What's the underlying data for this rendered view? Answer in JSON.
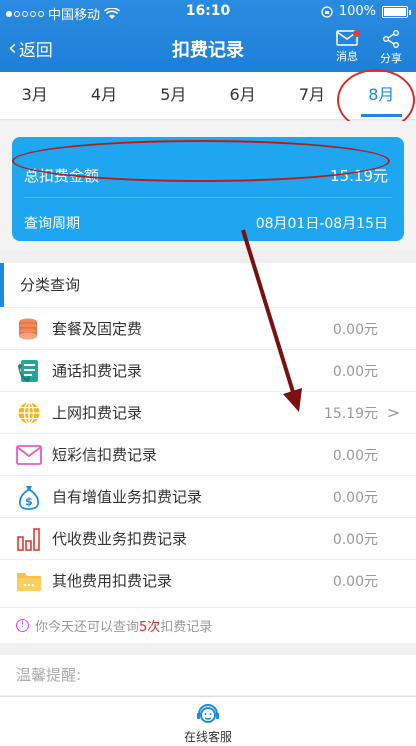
{
  "status_bar": {
    "carrier": "中国移动",
    "time": "16:10",
    "battery": "100%"
  },
  "nav": {
    "back_label": "返回",
    "title": "扣费记录",
    "message_label": "消息",
    "share_label": "分享"
  },
  "month_tabs": [
    {
      "label": "3月",
      "active": false
    },
    {
      "label": "4月",
      "active": false
    },
    {
      "label": "5月",
      "active": false
    },
    {
      "label": "6月",
      "active": false
    },
    {
      "label": "7月",
      "active": false
    },
    {
      "label": "8月",
      "active": true
    }
  ],
  "summary": {
    "total_label": "总扣费金额",
    "total_value": "15.19元",
    "period_label": "查询周期",
    "period_value": "08月01日-08月15日"
  },
  "category": {
    "title": "分类查询",
    "items": [
      {
        "icon": "coins-icon",
        "label": "套餐及固定费",
        "amount": "0.00元"
      },
      {
        "icon": "call-record-icon",
        "label": "通话扣费记录",
        "amount": "0.00元"
      },
      {
        "icon": "globe-icon",
        "label": "上网扣费记录",
        "amount": "15.19元",
        "chevron": ">"
      },
      {
        "icon": "envelope-icon",
        "label": "短彩信扣费记录",
        "amount": "0.00元"
      },
      {
        "icon": "money-bag-icon",
        "label": "自有增值业务扣费记录",
        "amount": "0.00元"
      },
      {
        "icon": "bar-chart-icon",
        "label": "代收费业务扣费记录",
        "amount": "0.00元"
      },
      {
        "icon": "folder-icon",
        "label": "其他费用扣费记录",
        "amount": "0.00元"
      }
    ],
    "notice_prefix": "你今天还可以查询",
    "notice_count": "5次",
    "notice_suffix": "扣费记录"
  },
  "tips": {
    "title": "温馨提醒:"
  },
  "bottom": {
    "service_label": "在线客服"
  },
  "colors": {
    "header_blue": "#1e7fd8",
    "card_blue": "#1ea6f0",
    "annotation_red": "#b71c1c"
  }
}
